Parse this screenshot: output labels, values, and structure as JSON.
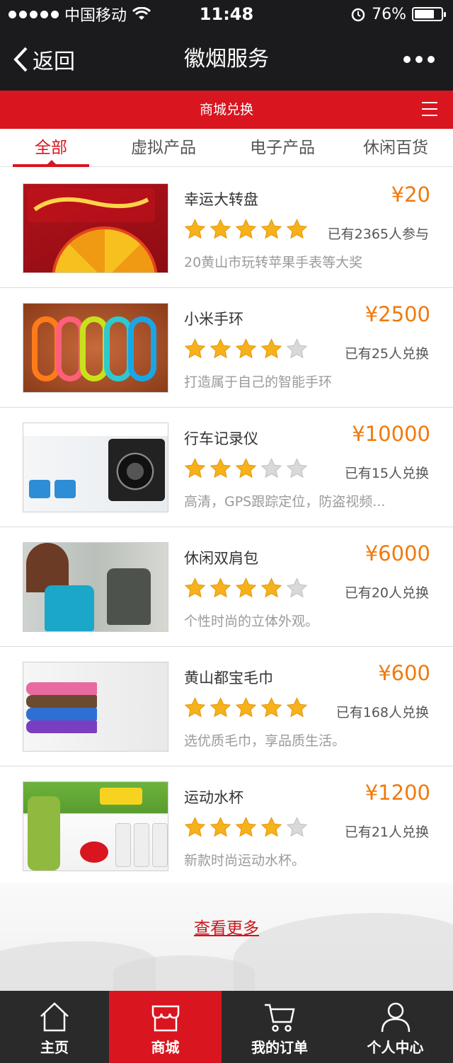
{
  "status_bar": {
    "carrier": "中国移动",
    "time": "11:48",
    "battery": "76%",
    "battery_level": 0.76
  },
  "nav": {
    "back_label": "返回",
    "title": "徽烟服务"
  },
  "header": {
    "title": "商城兑换"
  },
  "tabs": [
    {
      "label": "全部",
      "active": true
    },
    {
      "label": "虚拟产品",
      "active": false
    },
    {
      "label": "电子产品",
      "active": false
    },
    {
      "label": "休闲百货",
      "active": false
    }
  ],
  "products": [
    {
      "name": "幸运大转盘",
      "price": "¥20",
      "rating": 5,
      "count": "已有2365人参与",
      "desc": "20黄山市玩转苹果手表等大奖"
    },
    {
      "name": "小米手环",
      "price": "¥2500",
      "rating": 4,
      "count": "已有25人兑换",
      "desc": "打造属于自己的智能手环"
    },
    {
      "name": "行车记录仪",
      "price": "¥10000",
      "rating": 3,
      "count": "已有15人兑换",
      "desc": "高清，GPS跟踪定位，防盗视频..."
    },
    {
      "name": "休闲双肩包",
      "price": "¥6000",
      "rating": 4,
      "count": "已有20人兑换",
      "desc": "个性时尚的立体外观。"
    },
    {
      "name": "黄山都宝毛巾",
      "price": "¥600",
      "rating": 5,
      "count": "已有168人兑换",
      "desc": "选优质毛巾，享品质生活。"
    },
    {
      "name": "运动水杯",
      "price": "¥1200",
      "rating": 4,
      "count": "已有21人兑换",
      "desc": "新款时尚运动水杯。"
    }
  ],
  "view_more": "查看更多",
  "tab_bar": [
    {
      "label": "主页",
      "icon": "home-icon",
      "active": false
    },
    {
      "label": "商城",
      "icon": "shop-icon",
      "active": true
    },
    {
      "label": "我的订单",
      "icon": "cart-icon",
      "active": false
    },
    {
      "label": "个人中心",
      "icon": "user-icon",
      "active": false
    }
  ],
  "colors": {
    "primary_red": "#d9151f",
    "price_orange": "#f07a0d",
    "dark_bar": "#1b1b1d"
  }
}
